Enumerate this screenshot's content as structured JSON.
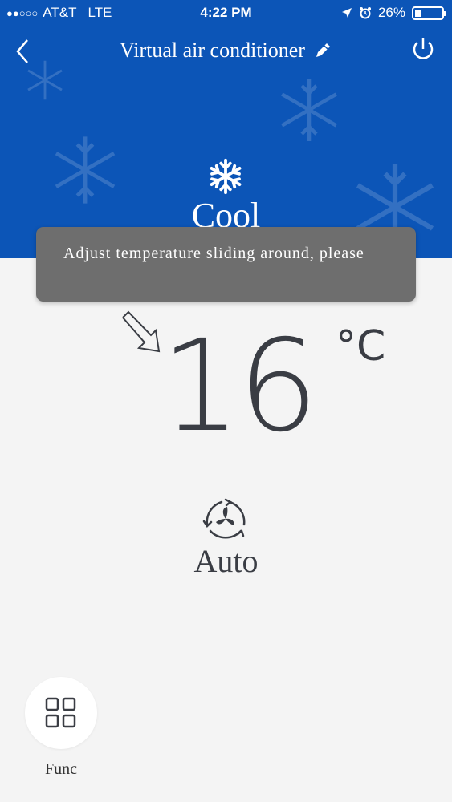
{
  "status_bar": {
    "signal_dots": "●●○○○",
    "carrier": "AT&T",
    "network": "LTE",
    "time": "4:22 PM",
    "battery_percent": "26%",
    "battery_level": 0.26
  },
  "nav": {
    "title": "Virtual air conditioner",
    "back_icon": "chevron-left-icon",
    "edit_icon": "pencil-icon",
    "power_icon": "power-icon"
  },
  "mode": {
    "icon": "snowflake-icon",
    "label": "Cool"
  },
  "toast": {
    "message": "Adjust temperature sliding around, please"
  },
  "temperature": {
    "value": "16",
    "unit": "°C"
  },
  "fan": {
    "icon": "fan-icon",
    "label": "Auto"
  },
  "func": {
    "icon": "grid-icon",
    "label": "Func"
  },
  "colors": {
    "header": "#0c55b7",
    "background": "#f4f4f4",
    "toast": "#6e6e6e",
    "text": "#3a3d44"
  }
}
